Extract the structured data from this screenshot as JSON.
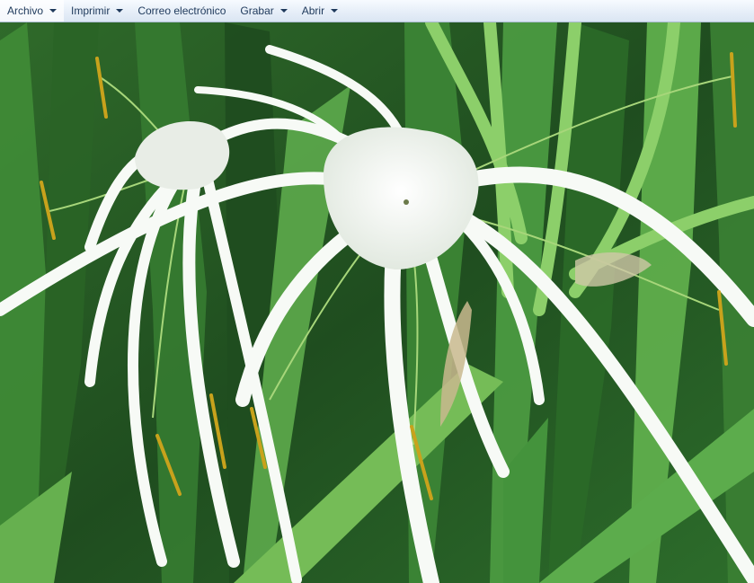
{
  "toolbar": {
    "items": [
      {
        "label": "Archivo",
        "has_menu": true
      },
      {
        "label": "Imprimir",
        "has_menu": true
      },
      {
        "label": "Correo electrónico",
        "has_menu": false
      },
      {
        "label": "Grabar",
        "has_menu": true
      },
      {
        "label": "Abrir",
        "has_menu": true
      }
    ]
  },
  "colors": {
    "toolbar_text": "#1e395b",
    "foliage_dark": "#15381a",
    "foliage_light": "#7ac25a",
    "petal": "#f7faf6",
    "anther": "#c8a21c"
  }
}
